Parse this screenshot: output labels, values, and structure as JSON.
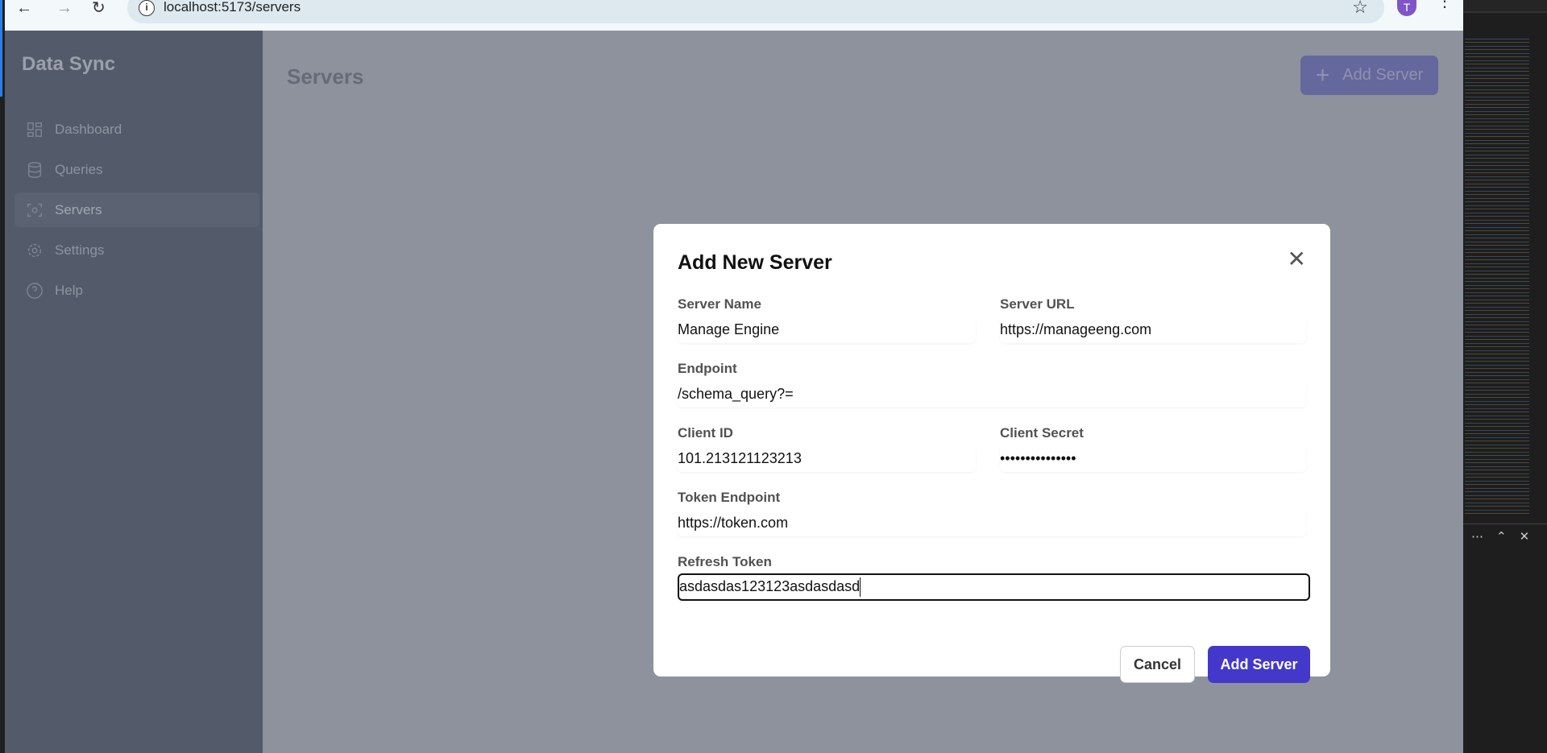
{
  "browser": {
    "url": "localhost:5173/servers",
    "avatar_initial": "T"
  },
  "sidebar": {
    "brand": "Data Sync",
    "items": [
      {
        "label": "Dashboard"
      },
      {
        "label": "Queries"
      },
      {
        "label": "Servers"
      },
      {
        "label": "Settings"
      },
      {
        "label": "Help"
      }
    ]
  },
  "main": {
    "title": "Servers",
    "add_button": "Add Server"
  },
  "modal": {
    "title": "Add New Server",
    "fields": {
      "server_name": {
        "label": "Server Name",
        "value": "Manage Engine"
      },
      "server_url": {
        "label": "Server URL",
        "value": "https://manageeng.com"
      },
      "endpoint": {
        "label": "Endpoint",
        "value": "/schema_query?="
      },
      "client_id": {
        "label": "Client ID",
        "value": "101.213121123213"
      },
      "client_secret": {
        "label": "Client Secret",
        "value": "•••••••••••••••"
      },
      "token_endpoint": {
        "label": "Token Endpoint",
        "value": "https://token.com"
      },
      "refresh_token": {
        "label": "Refresh Token",
        "value": "asdasdas123123asdasdasd"
      }
    },
    "cancel": "Cancel",
    "submit": "Add Server"
  },
  "colors": {
    "accent": "#4338ca",
    "sidebar": "#535a69",
    "overlay": "#8e929d"
  }
}
